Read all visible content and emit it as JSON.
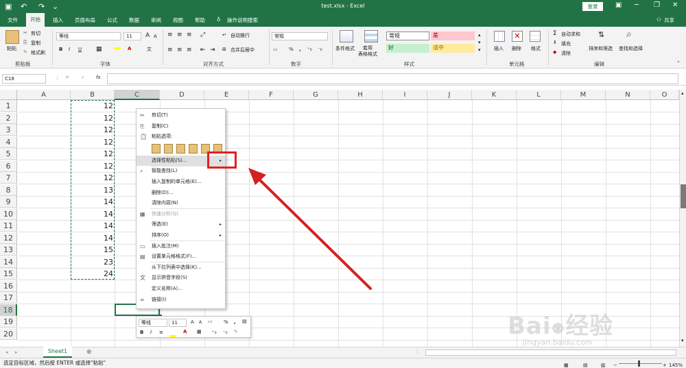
{
  "title_bar": {
    "filename_app": "test.xlsx  -  Excel",
    "login_label": "登录",
    "accent": "#217346"
  },
  "tabs": [
    {
      "label": "文件"
    },
    {
      "label": "开始"
    },
    {
      "label": "插入"
    },
    {
      "label": "页面布局"
    },
    {
      "label": "公式"
    },
    {
      "label": "数据"
    },
    {
      "label": "审阅"
    },
    {
      "label": "视图"
    },
    {
      "label": "帮助"
    },
    {
      "label": "操作说明搜索"
    }
  ],
  "share_label": "共享",
  "ribbon": {
    "clipboard": {
      "paste": "粘贴",
      "cut": "剪切",
      "copy": "复制",
      "format_painter": "格式刷",
      "label": "剪贴板"
    },
    "font": {
      "name": "等线",
      "size": "11",
      "label": "字体",
      "bold": "B",
      "italic": "I",
      "underline": "U"
    },
    "alignment": {
      "wrap": "自动换行",
      "merge": "合并后居中",
      "label": "对齐方式"
    },
    "number": {
      "format": "常规",
      "percent": "%",
      "comma": ",",
      "label": "数字"
    },
    "styles": {
      "cond_format": "条件格式",
      "table_format": "套用\n表格格式",
      "normal": "常规",
      "bad": "差",
      "good": "好",
      "neutral": "适中",
      "label": "样式"
    },
    "cells": {
      "insert": "插入",
      "delete": "删除",
      "format": "格式",
      "label": "单元格"
    },
    "editing": {
      "autosum": "自动求和",
      "fill": "填充",
      "clear": "清除",
      "sort_filter": "排序和筛选",
      "find_select": "查找和选择",
      "label": "编辑"
    }
  },
  "formula_bar": {
    "name_box": "C18",
    "fx": "fx",
    "cancel": "✕",
    "enter": "✓"
  },
  "columns": [
    "A",
    "B",
    "C",
    "D",
    "E",
    "F",
    "G",
    "H",
    "I",
    "J",
    "K",
    "L",
    "M",
    "N",
    "O"
  ],
  "rows": [
    "1",
    "2",
    "3",
    "4",
    "5",
    "6",
    "7",
    "8",
    "9",
    "10",
    "11",
    "12",
    "13",
    "14",
    "15",
    "16",
    "17",
    "18",
    "19",
    "20"
  ],
  "column_b_values": [
    "12",
    "12",
    "12",
    "12",
    "12",
    "12",
    "12",
    "13",
    "14",
    "14",
    "14",
    "14",
    "15",
    "23",
    "24"
  ],
  "context_menu": {
    "items": [
      {
        "label": "剪切(T)",
        "icon": "scissors-icon"
      },
      {
        "label": "复制(C)",
        "icon": "copy-icon"
      },
      {
        "label": "粘贴选项:",
        "icon": "paste-icon"
      },
      {
        "label": "选择性粘贴(S)...",
        "icon": "",
        "submenu": "▸",
        "highlight": true
      },
      {
        "label": "智能查找(L)",
        "icon": "search-icon"
      },
      {
        "label": "插入复制的单元格(E)...",
        "icon": ""
      },
      {
        "label": "删除(D)...",
        "icon": ""
      },
      {
        "label": "清除内容(N)",
        "icon": ""
      },
      {
        "label": "快速分析(Q)",
        "icon": "quick-analysis-icon",
        "disabled": true
      },
      {
        "label": "筛选(E)",
        "icon": "",
        "submenu": "▸"
      },
      {
        "label": "排序(O)",
        "icon": "",
        "submenu": "▸"
      },
      {
        "label": "插入批注(M)",
        "icon": "comment-icon"
      },
      {
        "label": "设置单元格格式(F)...",
        "icon": "format-cells-icon"
      },
      {
        "label": "从下拉列表中选择(K)...",
        "icon": ""
      },
      {
        "label": "显示拼音字段(S)",
        "icon": "phonetic-icon"
      },
      {
        "label": "定义名称(A)...",
        "icon": ""
      },
      {
        "label": "链接(I)",
        "icon": "link-icon"
      }
    ]
  },
  "mini_toolbar": {
    "font": "等线",
    "size": "11",
    "percent": "%",
    "comma": ",",
    "bold": "B",
    "italic": "I"
  },
  "sheet_tab": "Sheet1",
  "status_text": "选定目标区域，然后按 ENTER 或选择\"粘贴\"",
  "zoom": "145%",
  "watermark": {
    "brand": "Bai",
    "brand2": "经验",
    "url": "jingyan.baidu.com"
  },
  "colors": {
    "highlight_box": "#e02020",
    "arrow": "#d42020",
    "bad_bg": "#ffc7ce",
    "good_bg": "#c6efce",
    "neutral_bg": "#ffeb9c",
    "bad_fg": "#9c0006",
    "good_fg": "#006100",
    "neutral_fg": "#9c5700"
  }
}
